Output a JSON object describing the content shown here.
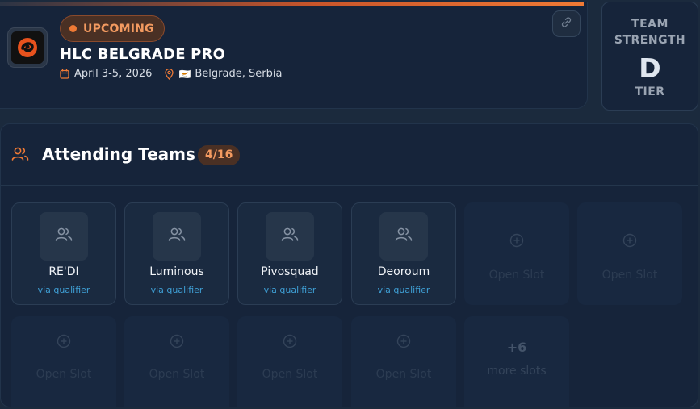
{
  "event": {
    "status": "UPCOMING",
    "title": "HLC BELGRADE PRO",
    "dates": "April 3-5, 2026",
    "location": "Belgrade, Serbia",
    "flag": "🇨🇾",
    "status_color": "#f07a35"
  },
  "tier": {
    "label_top": "TEAM STRENGTH",
    "grade": "D",
    "label_bottom": "TIER"
  },
  "teams_section": {
    "title": "Attending Teams",
    "count": "4/16",
    "teams": [
      {
        "name": "RE'DI",
        "via": "via qualifier"
      },
      {
        "name": "Luminous",
        "via": "via qualifier"
      },
      {
        "name": "Pivosquad",
        "via": "via qualifier"
      },
      {
        "name": "Deoroum",
        "via": "via qualifier"
      }
    ],
    "open_slot_label": "Open Slot",
    "more": {
      "count": "+6",
      "label": "more slots"
    }
  },
  "colors": {
    "accent": "#f07a35",
    "link_blue": "#3fa0d6",
    "card_bg": "#16243a",
    "page_bg": "#1b2a3d"
  }
}
